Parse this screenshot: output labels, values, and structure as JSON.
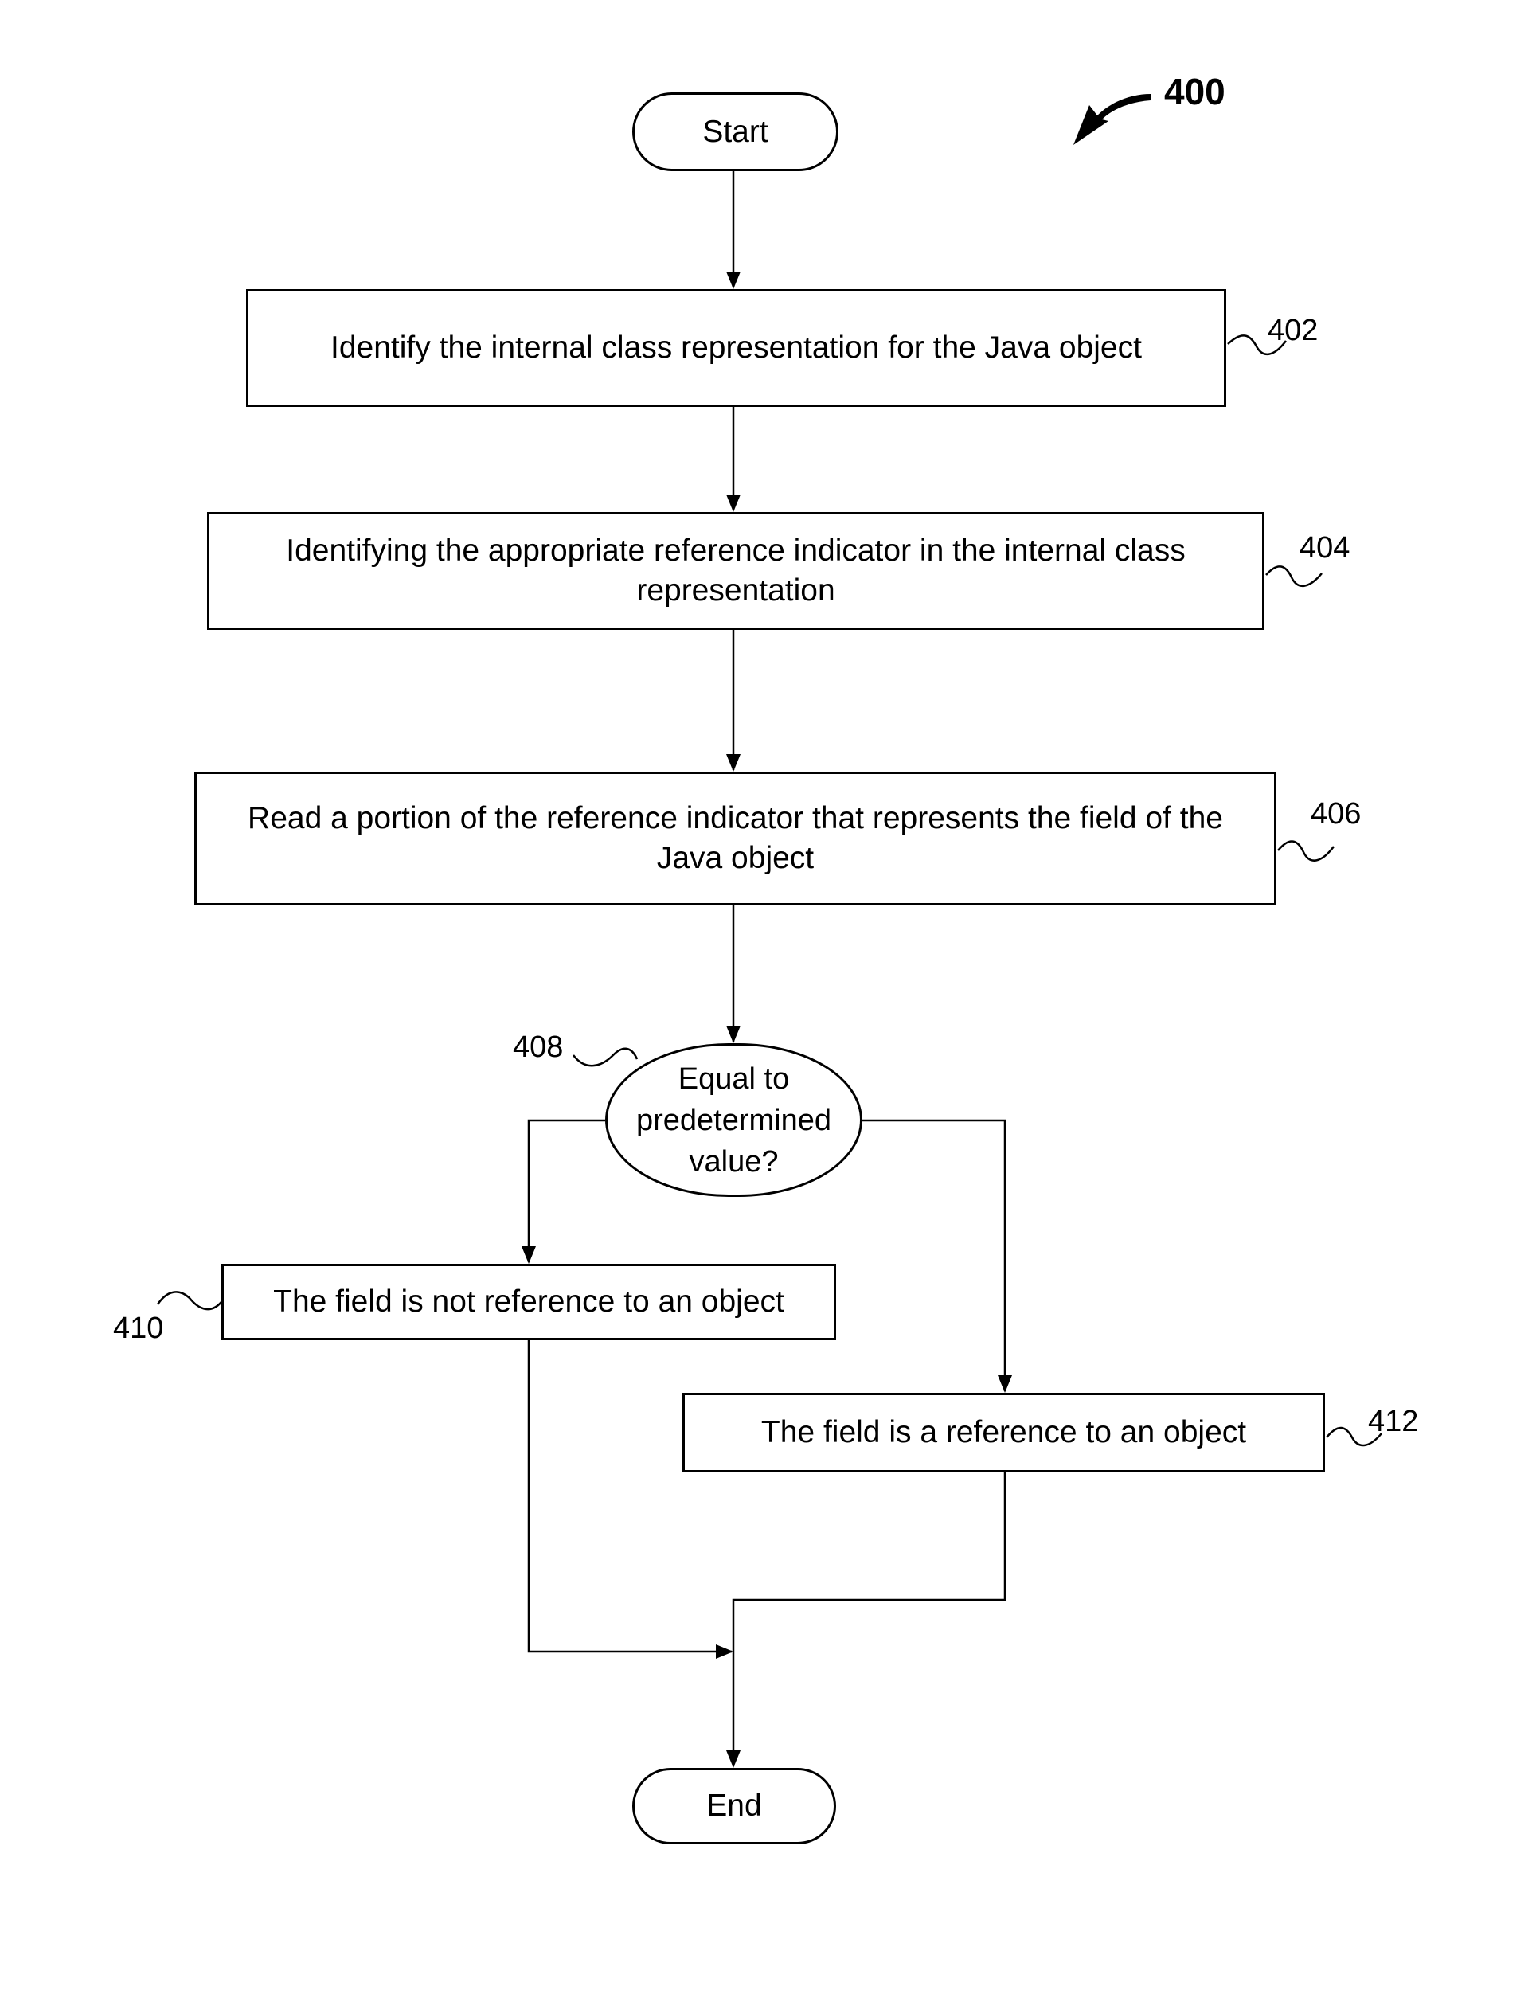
{
  "figure": {
    "number": "400"
  },
  "nodes": {
    "start": {
      "label": "Start"
    },
    "n402": {
      "ref": "402",
      "label": "Identify  the internal class representation for the Java object"
    },
    "n404": {
      "ref": "404",
      "label": "Identifying  the appropriate reference indicator in the internal class representation"
    },
    "n406": {
      "ref": "406",
      "label": "Read a portion of the reference indicator that represents the field of the Java object"
    },
    "n408": {
      "ref": "408",
      "label": "Equal to predetermined value?"
    },
    "n410": {
      "ref": "410",
      "label": "The field is not reference to an object"
    },
    "n412": {
      "ref": "412",
      "label": "The field is a reference to an object"
    },
    "end": {
      "label": "End"
    }
  }
}
